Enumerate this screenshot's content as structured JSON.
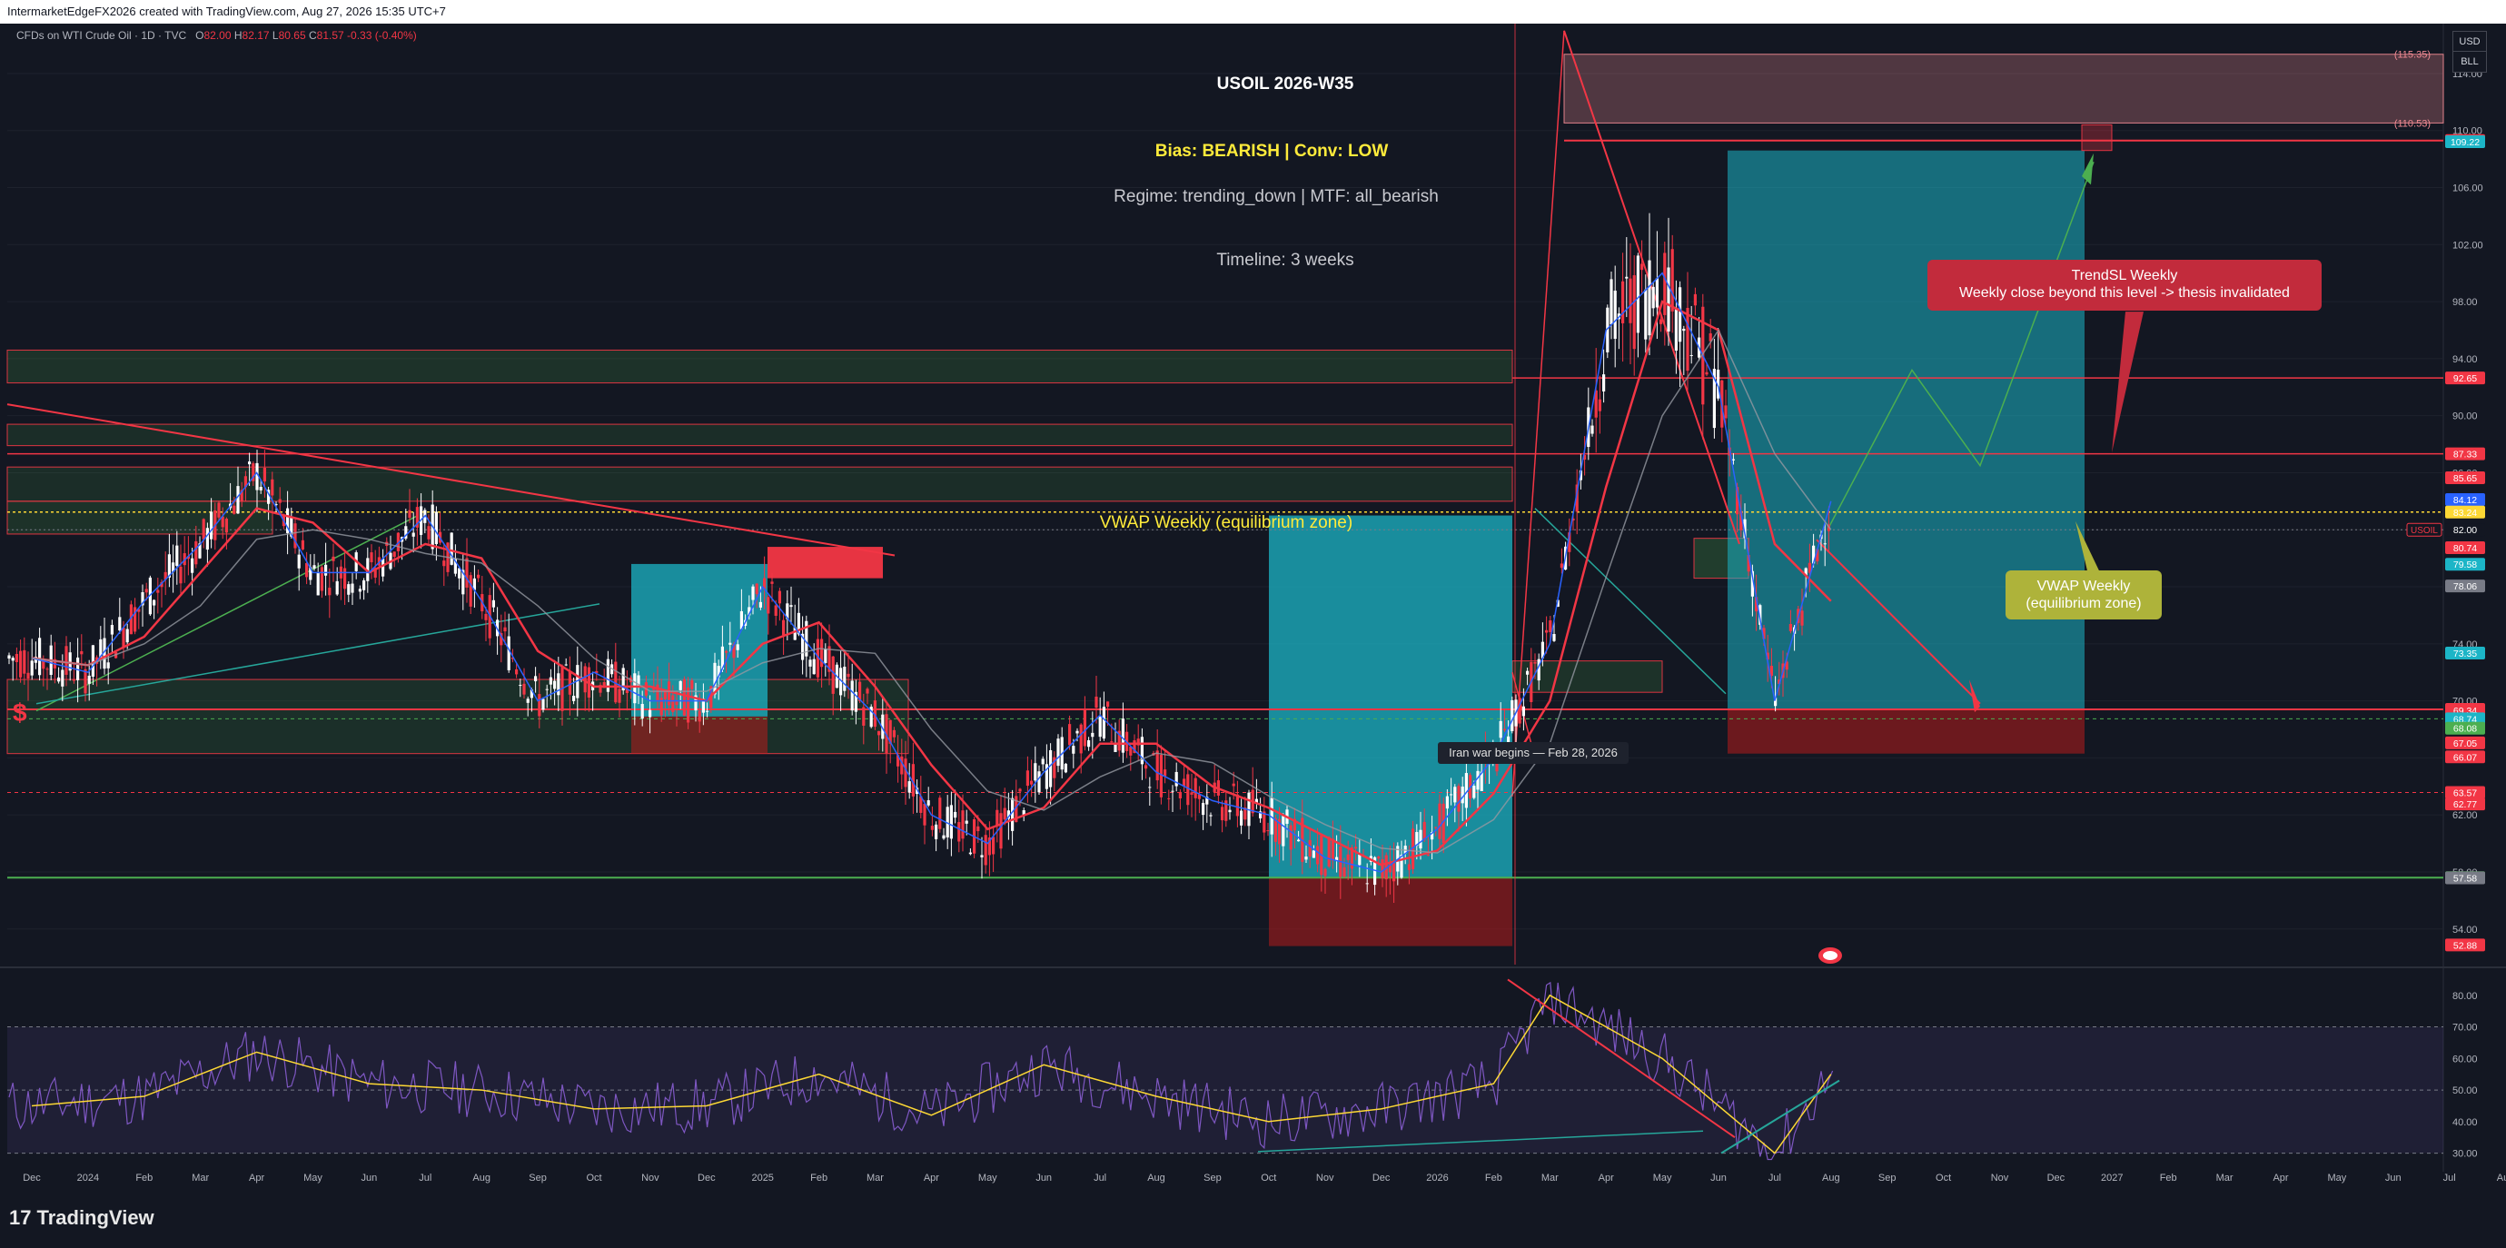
{
  "header": {
    "attribution": "IntermarketEdgeFX2026 created with TradingView.com, Aug 27, 2026 15:35 UTC+7",
    "symbol_desc": "CFDs on WTI Crude Oil · 1D · TVC",
    "ohlc": {
      "o_label": "O",
      "o": "82.00",
      "h_label": "H",
      "h": "82.17",
      "l_label": "L",
      "l": "80.65",
      "c_label": "C",
      "c": "81.57",
      "change": "-0.33 (-0.40%)"
    }
  },
  "scale_units": {
    "currency": "USD",
    "unit": "BLL"
  },
  "annotations": {
    "title": "USOIL 2026-W35",
    "bias": "Bias: BEARISH | Conv: LOW",
    "regime": "Regime: trending_down | MTF: all_bearish",
    "timeline": "Timeline: 3 weeks",
    "vwap_label": "VWAP Weekly (equilibrium zone)",
    "iran_event": "Iran war begins — Feb 28, 2026",
    "trendsl_title": "TrendSL Weekly",
    "trendsl_desc": "Weekly close beyond this level -> thesis invalidated",
    "vwap_callout_1": "VWAP Weekly",
    "vwap_callout_2": "(equilibrium zone)",
    "usoil_tag": "USOIL"
  },
  "footer": {
    "brand": "TradingView",
    "mark": "17"
  },
  "colors": {
    "background": "#131722",
    "bull": "#ffffff",
    "bear": "#f23645",
    "ema_red": "#f23645",
    "ema_blue": "#2962ff",
    "rsi": "#7e57c2",
    "rsi_ma": "#fdd835",
    "target_zone": "#1cb5c7",
    "stop_zone": "#b71c1c",
    "support_green": "#4caf50",
    "bias_yellow": "#ffeb3b"
  },
  "chart_data": [
    {
      "type": "line",
      "title": "USOIL 2026-W35",
      "xlabel": "",
      "ylabel": "",
      "x_tick_labels": [
        "Dec",
        "2024",
        "Feb",
        "Mar",
        "Apr",
        "May",
        "Jun",
        "Jul",
        "Aug",
        "Sep",
        "Oct",
        "Nov",
        "Dec",
        "2025",
        "Feb",
        "Mar",
        "Apr",
        "May",
        "Jun",
        "Jul",
        "Aug",
        "Sep",
        "Oct",
        "Nov",
        "Dec",
        "2026",
        "Feb",
        "Mar",
        "Apr",
        "May",
        "Jun",
        "Jul",
        "Aug",
        "Sep",
        "Oct",
        "Nov",
        "Dec",
        "2027",
        "Feb",
        "Mar",
        "Apr",
        "May",
        "Jun",
        "Jul",
        "Aug"
      ],
      "y_ticks": [
        "114.00",
        "110.00",
        "106.00",
        "102.00",
        "98.00",
        "94.00",
        "90.00",
        "86.00",
        "82.00",
        "78.00",
        "74.00",
        "70.00",
        "66.00",
        "62.00",
        "58.00",
        "54.00"
      ],
      "ylim": [
        51.5,
        117.5
      ],
      "series": [
        {
          "x": [
            "2023-12",
            "2024-01",
            "2024-02",
            "2024-03",
            "2024-04",
            "2024-05",
            "2024-06",
            "2024-07",
            "2024-08",
            "2024-09",
            "2024-10",
            "2024-11",
            "2024-12",
            "2025-01",
            "2025-02",
            "2025-03",
            "2025-04",
            "2025-05",
            "2025-06",
            "2025-07",
            "2025-08",
            "2025-09",
            "2025-10",
            "2025-11",
            "2025-12",
            "2026-01",
            "2026-02",
            "2026-03",
            "2026-04",
            "2026-05",
            "2026-06",
            "2026-07",
            "2026-08"
          ],
          "values": [
            73,
            72,
            77,
            81,
            86,
            79,
            79,
            83,
            77,
            70,
            72,
            70,
            70,
            78,
            73,
            69,
            62,
            60,
            65,
            69,
            65,
            63,
            62,
            59,
            58,
            61,
            66,
            74,
            96,
            100,
            92,
            70,
            84
          ]
        }
      ],
      "price_levels": [
        {
          "value": "(115.35)",
          "kind": "zone-top"
        },
        {
          "value": "(110.53)",
          "kind": "zone-bottom"
        },
        {
          "value": "109.30",
          "color": "#f23645"
        },
        {
          "value": "109.22",
          "color": "#1cb5c7"
        },
        {
          "value": "92.65",
          "color": "#f23645"
        },
        {
          "value": "87.33",
          "color": "#f23645"
        },
        {
          "value": "85.65",
          "color": "#f23645"
        },
        {
          "value": "84.12",
          "color": "#2962ff"
        },
        {
          "value": "83.24",
          "color": "#fdd835"
        },
        {
          "value": "82.00",
          "color": "#131722"
        },
        {
          "value": "80.74",
          "color": "#f23645"
        },
        {
          "value": "79.58",
          "color": "#1cb5c7"
        },
        {
          "value": "78.06",
          "color": "#787b86"
        },
        {
          "value": "73.35",
          "color": "#1cb5c7"
        },
        {
          "value": "69.40",
          "color": "#f23645"
        },
        {
          "value": "69.34",
          "color": "#f23645"
        },
        {
          "value": "68.74",
          "color": "#1cb5c7"
        },
        {
          "value": "68.08",
          "color": "#4caf50"
        },
        {
          "value": "67.05",
          "color": "#f23645"
        },
        {
          "value": "66.07",
          "color": "#f23645"
        },
        {
          "value": "63.57",
          "color": "#f23645"
        },
        {
          "value": "62.77",
          "color": "#f23645"
        },
        {
          "value": "57.60",
          "color": "#4caf50"
        },
        {
          "value": "57.58",
          "color": "#787b86"
        },
        {
          "value": "52.88",
          "color": "#f23645"
        }
      ]
    },
    {
      "type": "line",
      "title": "",
      "y_ticks": [
        "80.00",
        "70.00",
        "60.00",
        "50.00",
        "40.00",
        "30.00"
      ],
      "ylim": [
        27,
        88
      ],
      "series": [
        {
          "x": [
            "2023-12",
            "2024-02",
            "2024-04",
            "2024-06",
            "2024-08",
            "2024-10",
            "2024-12",
            "2025-02",
            "2025-04",
            "2025-06",
            "2025-08",
            "2025-10",
            "2025-12",
            "2026-02",
            "2026-03",
            "2026-05",
            "2026-07",
            "2026-08"
          ],
          "values": [
            45,
            48,
            62,
            52,
            50,
            44,
            45,
            55,
            42,
            58,
            48,
            40,
            44,
            52,
            80,
            60,
            30,
            55
          ]
        }
      ]
    }
  ]
}
